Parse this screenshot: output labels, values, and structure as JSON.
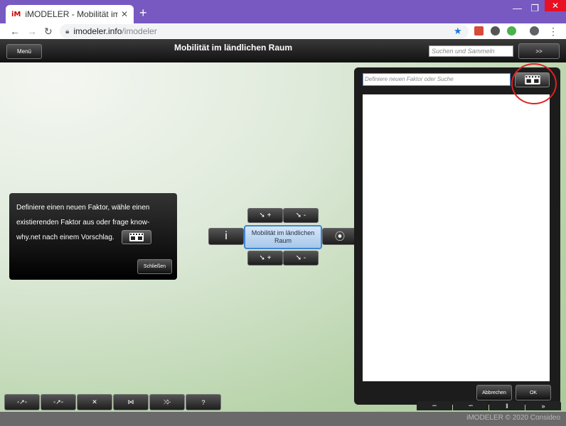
{
  "browser": {
    "tab_title": "iMODELER - Mobilität im ländlic",
    "favicon_text": "iM",
    "url_host": "imodeler.info",
    "url_path": "/imodeler"
  },
  "app": {
    "menu_label": "Menü",
    "title": "Mobilität im ländlichen Raum",
    "search_placeholder": "Suchen und Sammeln",
    "expand_label": ">>"
  },
  "panel": {
    "input_placeholder": "Definiere neuen Faktor oder Suche",
    "cancel_label": "Abbrechen",
    "ok_label": "OK"
  },
  "node": {
    "label": "Mobilität im ländlichen Raum",
    "info_label": "i",
    "plus_label": "+",
    "minus_label": "-"
  },
  "tooltip": {
    "text": "Definiere einen neuen Faktor, wähle einen existierenden Faktor aus oder frage know-why.net nach einem Vorschlag.",
    "close_label": "Schließen"
  },
  "bottom_toolbar": {
    "help_label": "?"
  },
  "footer": {
    "copyright": "iMODELER © 2020 Consideo",
    "partial_1": "‖",
    "partial_2": "»"
  }
}
